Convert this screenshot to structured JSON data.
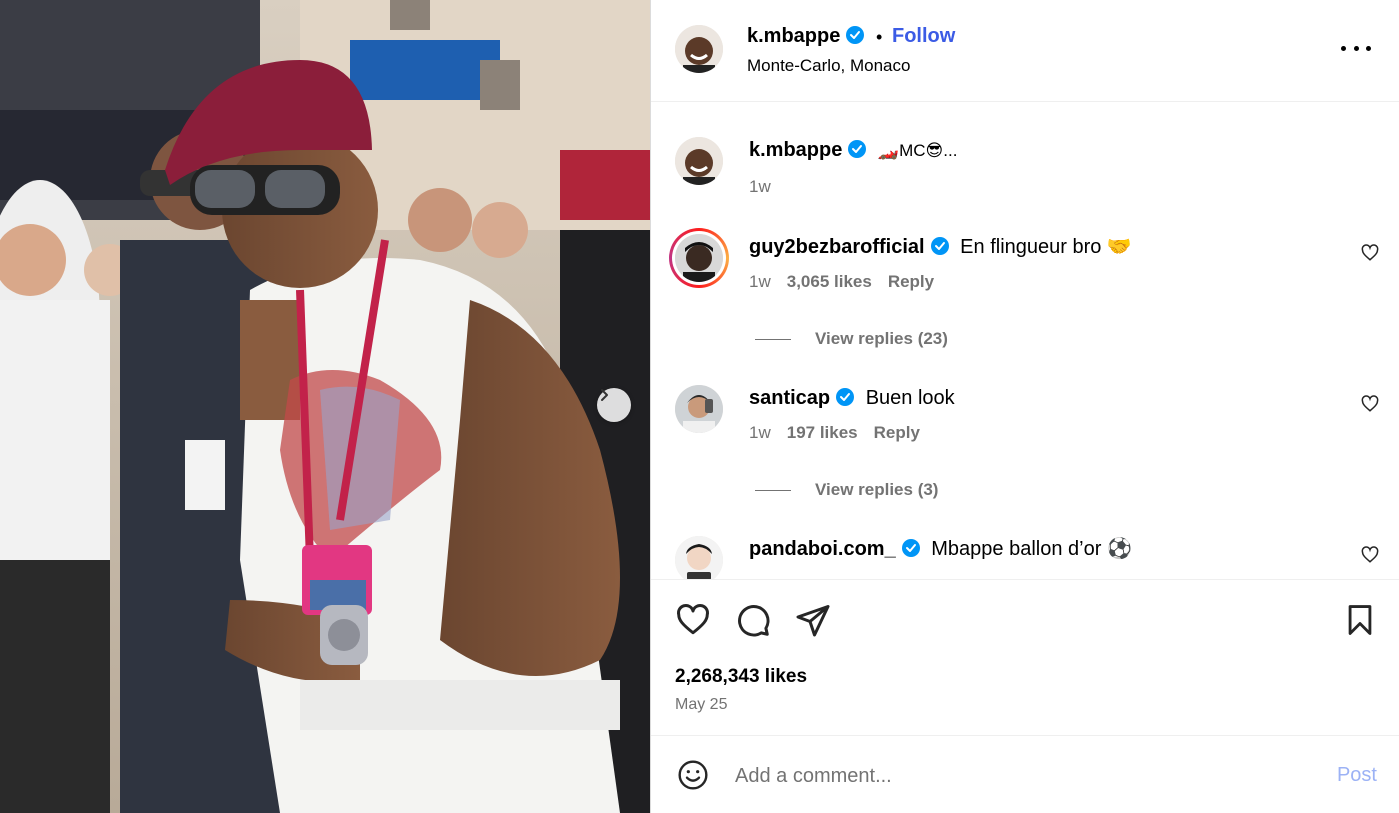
{
  "post": {
    "author": "k.mbappe",
    "follow_label": "Follow",
    "separator": "•",
    "location": "Monte-Carlo, Monaco",
    "caption": {
      "username": "k.mbappe",
      "text": "🏎️MC😎...",
      "age": "1w"
    }
  },
  "comments": [
    {
      "username": "guy2bezbarofficial",
      "text": "En flingueur bro 🤝",
      "age": "1w",
      "likes": "3,065 likes",
      "reply_label": "Reply",
      "view_replies": "View replies (23)"
    },
    {
      "username": "santicap",
      "text": "Buen look",
      "age": "1w",
      "likes": "197 likes",
      "reply_label": "Reply",
      "view_replies": "View replies (3)"
    },
    {
      "username": "pandaboi.com_",
      "text": "Mbappe ballon d’or ⚽"
    }
  ],
  "stats": {
    "likes": "2,268,343 likes",
    "date": "May 25"
  },
  "compose": {
    "placeholder": "Add a comment...",
    "post_label": "Post"
  },
  "colors": {
    "accent": "#3b5be5",
    "verified": "#0095f6",
    "muted": "#737373",
    "post_disabled": "#9cb2f5"
  },
  "icons": {
    "verified": "verified-badge-icon",
    "more": "more-options-icon",
    "like": "heart-icon",
    "comment": "comment-icon",
    "share": "share-icon",
    "save": "bookmark-icon",
    "emoji": "emoji-icon",
    "next": "chevron-right-icon"
  }
}
